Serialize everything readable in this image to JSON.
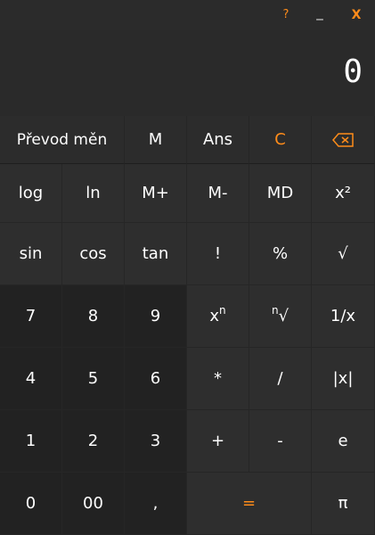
{
  "window": {
    "help_label": "?",
    "minimize_label": "_",
    "close_label": "X"
  },
  "display": {
    "value": "0"
  },
  "row0": {
    "convert": "Převod měn",
    "memory": "M",
    "ans": "Ans",
    "clear": "C"
  },
  "row1": {
    "log": "log",
    "ln": "ln",
    "mplus": "M+",
    "mminus": "M-",
    "md": "MD",
    "square": "x²"
  },
  "row2": {
    "sin": "sin",
    "cos": "cos",
    "tan": "tan",
    "fact": "!",
    "percent": "%",
    "sqrt": "√"
  },
  "row3": {
    "seven": "7",
    "eight": "8",
    "nine": "9",
    "pow_base": "x",
    "pow_exp": "n",
    "root_index": "n",
    "root_sign": "√",
    "reciprocal": "1/x"
  },
  "row4": {
    "four": "4",
    "five": "5",
    "six": "6",
    "multiply": "*",
    "divide": "/",
    "abs": "|x|"
  },
  "row5": {
    "one": "1",
    "two": "2",
    "three": "3",
    "plus": "+",
    "minus": "-",
    "e": "e"
  },
  "row6": {
    "zero": "0",
    "double_zero": "00",
    "comma": ",",
    "equals": "=",
    "pi": "π"
  },
  "colors": {
    "accent": "#ff8c1a",
    "key_bg": "#2e2e2e",
    "digit_bg": "#222222",
    "window_bg": "#2a2a2a"
  }
}
